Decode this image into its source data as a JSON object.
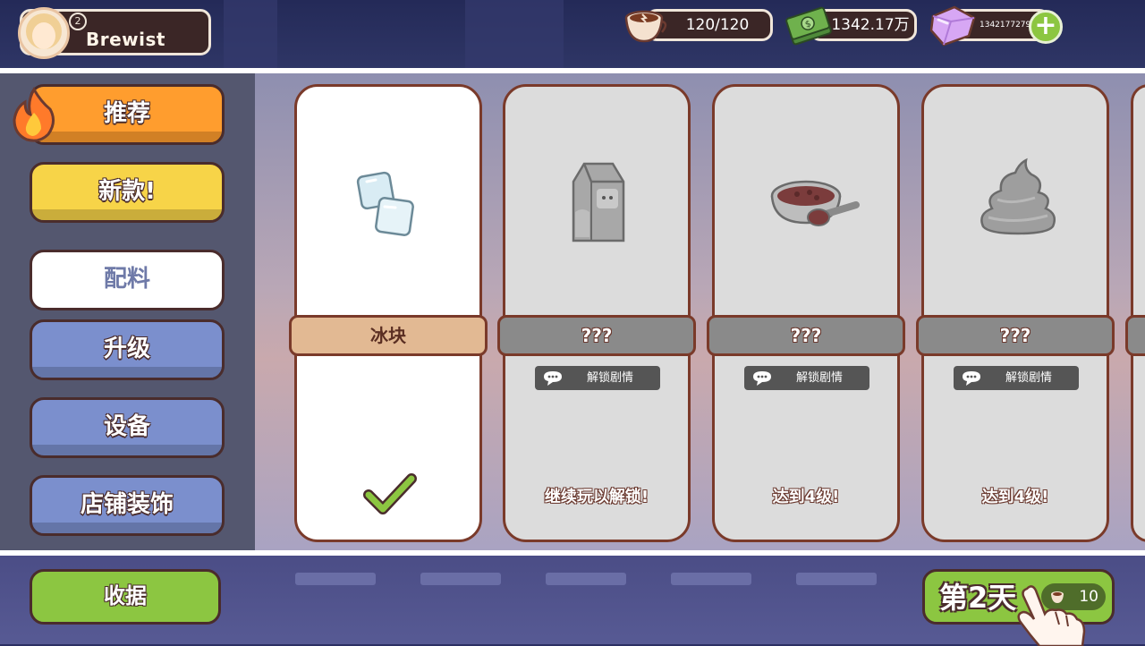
{
  "hud": {
    "player_name": "Brewist",
    "player_level": "2",
    "coffee": "120/120",
    "cash": "1342.17万",
    "gems": "1342177279",
    "plus_label": "+"
  },
  "menu": {
    "items": [
      {
        "label": "推荐",
        "style": "orange"
      },
      {
        "label": "新款!",
        "style": "yellow"
      },
      {
        "label": "配料",
        "style": "white"
      },
      {
        "label": "升级",
        "style": "blue"
      },
      {
        "label": "设备",
        "style": "blue"
      },
      {
        "label": "店铺装饰",
        "style": "blue"
      }
    ]
  },
  "cards": [
    {
      "name": "冰块",
      "icon": "ice-cube-icon",
      "state": "unlocked",
      "hint": ""
    },
    {
      "name": "???",
      "icon": "milk-carton-icon",
      "state": "locked",
      "tag": "解锁剧情",
      "hint": "继续玩以解锁!"
    },
    {
      "name": "???",
      "icon": "red-bean-bowl-icon",
      "state": "locked",
      "tag": "解锁剧情",
      "hint": "达到4级!"
    },
    {
      "name": "???",
      "icon": "whipped-cream-icon",
      "state": "locked",
      "tag": "解锁剧情",
      "hint": "达到4级!"
    }
  ],
  "bottom": {
    "collect_label": "收据",
    "day_label": "第2天",
    "day_cost": "10"
  },
  "colors": {
    "accent_green": "#8cc641",
    "card_border": "#7a3a2a",
    "menu_orange": "#ff9d2e",
    "menu_yellow": "#f7d448",
    "menu_blue": "#7b8fcd"
  }
}
